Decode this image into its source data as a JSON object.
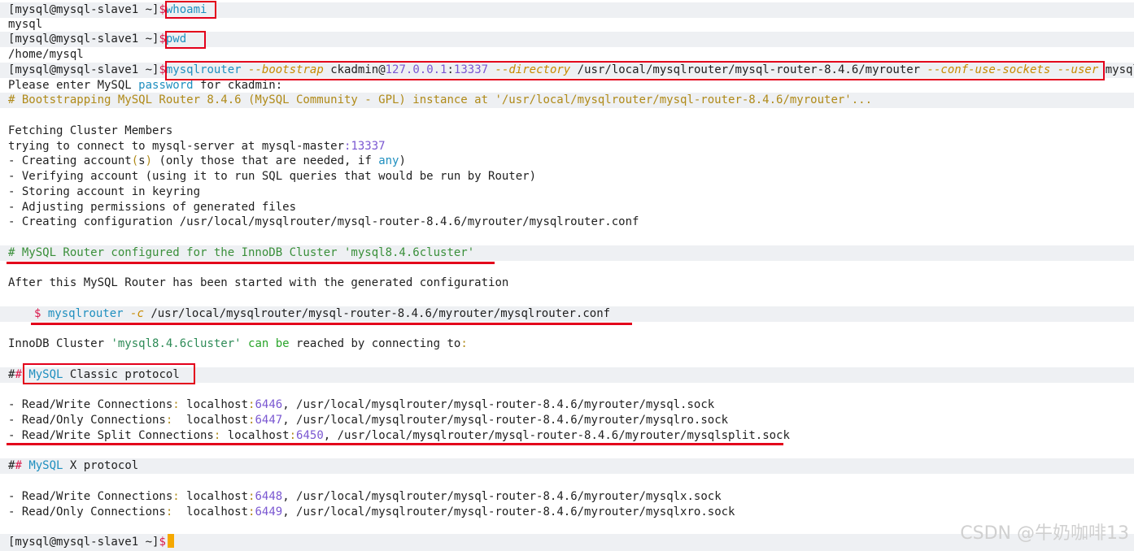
{
  "prompt": "[mysql@mysql-slave1 ~]",
  "dollar": "$",
  "cmd1": "whoami",
  "out1": "mysql",
  "cmd2": "pwd",
  "out2": "/home/mysql",
  "cmd3": {
    "bin": "mysqlrouter",
    "flag_bootstrap": "--bootstrap",
    "user_host": "ckadmin@",
    "ip": "127.0.0.1",
    "colon": ":",
    "port": "13337",
    "flag_directory": "--directory",
    "dir": "/usr/local/mysqlrouter/mysql-router-8.4.6/myrouter",
    "flag_sockets": "--conf-use-sockets",
    "flag_user": "--user",
    "user": "mysql"
  },
  "password_line": {
    "a": "Please enter MySQL ",
    "b": "password",
    "c": " for ckadmin:"
  },
  "bootstrapping": "# Bootstrapping MySQL Router 8.4.6 (MySQL Community - GPL) instance at '/usr/local/mysqlrouter/mysql-router-8.4.6/myrouter'...",
  "fetching": "Fetching Cluster Members",
  "trying": {
    "a": "trying to connect to mysql-server at mysql-master",
    "b": ":",
    "c": "13337"
  },
  "creating_accounts": {
    "a": "- Creating account",
    "b": "(",
    "c": "s",
    "d": ")",
    "e": " (only those that are needed, if ",
    "f": "any",
    "g": ")"
  },
  "verifying": "- Verifying account (using it to run SQL queries that would be run by Router)",
  "storing": "- Storing account in keyring",
  "adjusting": "- Adjusting permissions of generated files",
  "creating_config": "- Creating configuration /usr/local/mysqlrouter/mysql-router-8.4.6/myrouter/mysqlrouter.conf",
  "configured": "# MySQL Router configured for the InnoDB Cluster 'mysql8.4.6cluster'",
  "after": "After this MySQL Router has been started with the generated configuration",
  "run_cmd": {
    "dollar": "$",
    "bin": "mysqlrouter",
    "flag": "-c",
    "path": "/usr/local/mysqlrouter/mysql-router-8.4.6/myrouter/mysqlrouter.conf"
  },
  "reached": {
    "a": "InnoDB Cluster ",
    "b": "'mysql8.4.6cluster'",
    "c": " can be",
    "d": " reached by connecting to",
    "e": ":"
  },
  "classic": {
    "hash1": "#",
    "hash2": "#",
    "a": "MySQL",
    "b": " Classic protocol"
  },
  "classic_rows": [
    {
      "label": "- Read/Write Connections",
      "colon": ":",
      "pad": " ",
      "host": "localhost",
      "port": "6446",
      "path": ", /usr/local/mysqlrouter/mysql-router-8.4.6/myrouter/mysql.sock"
    },
    {
      "label": "- Read/Only Connections",
      "colon": ":",
      "pad": "  ",
      "host": "localhost",
      "port": "6447",
      "path": ", /usr/local/mysqlrouter/mysql-router-8.4.6/myrouter/mysqlro.sock"
    },
    {
      "label": "- Read/Write Split Connections",
      "colon": ":",
      "pad": " ",
      "host": "localhost",
      "port": "6450",
      "path": ", /usr/local/mysqlrouter/mysql-router-8.4.6/myrouter/mysqlsplit.sock"
    }
  ],
  "xproto": {
    "hash1": "#",
    "hash2": "#",
    "a": "MySQL",
    "b": " X protocol"
  },
  "x_rows": [
    {
      "label": "- Read/Write Connections",
      "colon": ":",
      "pad": " ",
      "host": "localhost",
      "port": "6448",
      "path": ", /usr/local/mysqlrouter/mysql-router-8.4.6/myrouter/mysqlx.sock"
    },
    {
      "label": "- Read/Only Connections",
      "colon": ":",
      "pad": "  ",
      "host": "localhost",
      "port": "6449",
      "path": ", /usr/local/mysqlrouter/mysql-router-8.4.6/myrouter/mysqlxro.sock"
    }
  ],
  "watermark": "CSDN @牛奶咖啡13"
}
